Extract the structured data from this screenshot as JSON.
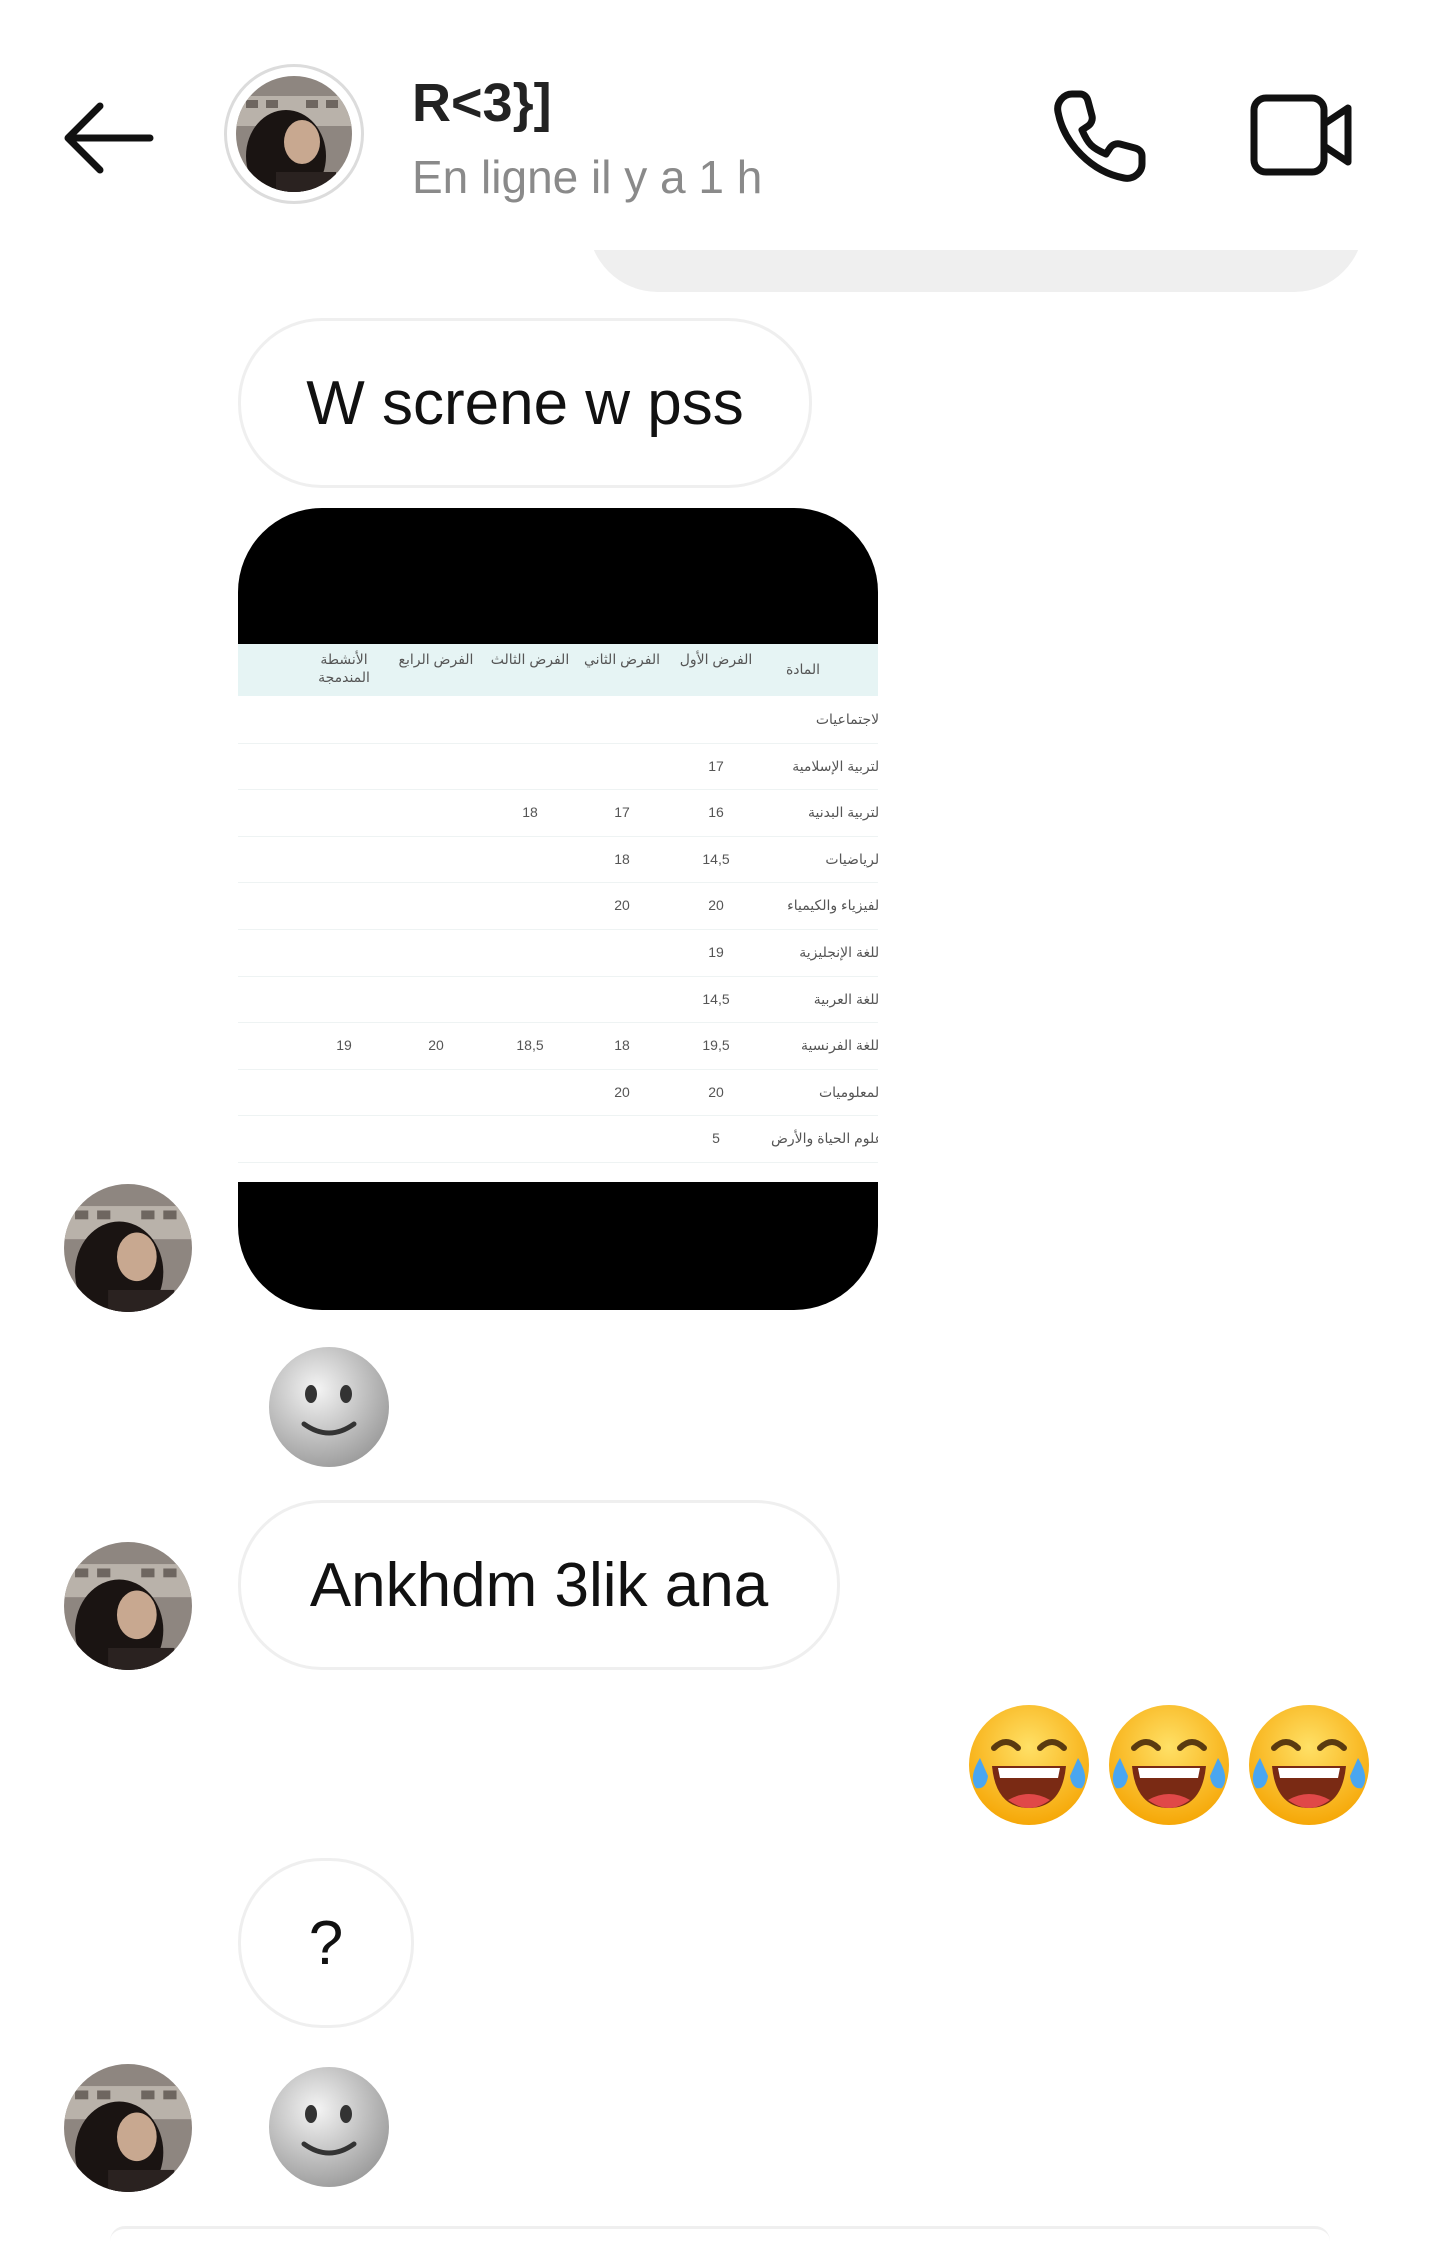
{
  "header": {
    "contact_name": "R<3}]",
    "status": "En ligne il y a 1 h"
  },
  "messages": {
    "msg1": "W screne w pss",
    "msg2": "Ankhdm 3lik ana",
    "msg3": "?"
  },
  "grade_sheet": {
    "headers": [
      "المادة",
      "الفرض الأول",
      "الفرض الثاني",
      "الفرض الثالث",
      "الفرض الرابع",
      "الأنشطة المندمجة"
    ],
    "rows": [
      {
        "subject": "الاجتماعيات",
        "grades": [
          "",
          "",
          "",
          "",
          ""
        ]
      },
      {
        "subject": "التربية الإسلامية",
        "grades": [
          "17",
          "",
          "",
          "",
          ""
        ]
      },
      {
        "subject": "التربية البدنية",
        "grades": [
          "16",
          "17",
          "18",
          "",
          ""
        ]
      },
      {
        "subject": "الرياضيات",
        "grades": [
          "14,5",
          "18",
          "",
          "",
          ""
        ]
      },
      {
        "subject": "الفيزياء والكيمياء",
        "grades": [
          "20",
          "20",
          "",
          "",
          ""
        ]
      },
      {
        "subject": "اللغة الإنجليزية",
        "grades": [
          "19",
          "",
          "",
          "",
          ""
        ]
      },
      {
        "subject": "اللغة العربية",
        "grades": [
          "14,5",
          "",
          "",
          "",
          ""
        ]
      },
      {
        "subject": "اللغة الفرنسية",
        "grades": [
          "19,5",
          "18",
          "18,5",
          "20",
          "19"
        ]
      },
      {
        "subject": "المعلوميات",
        "grades": [
          "20",
          "20",
          "",
          "",
          ""
        ]
      },
      {
        "subject": "علوم الحياة والأرض",
        "grades": [
          "5",
          "",
          "",
          "",
          ""
        ]
      }
    ]
  },
  "emojis": {
    "moon": "moon-face",
    "laugh": "face-with-tears-of-joy"
  }
}
